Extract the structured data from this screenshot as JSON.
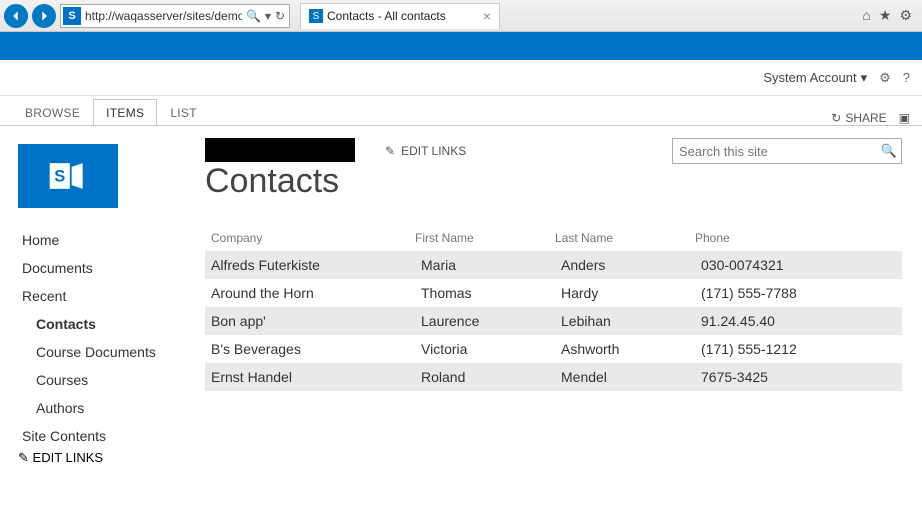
{
  "browser": {
    "url": "http://waqasserver/sites/demo",
    "tab_title": "Contacts - All contacts",
    "home_tip": "Home",
    "fav_tip": "Favorites",
    "tools_tip": "Tools"
  },
  "suite": {
    "account_label": "System Account"
  },
  "ribbon": {
    "tabs": [
      "BROWSE",
      "ITEMS",
      "LIST"
    ],
    "share_label": "SHARE"
  },
  "search": {
    "placeholder": "Search this site"
  },
  "page": {
    "title": "Contacts",
    "edit_links": "EDIT LINKS"
  },
  "nav": [
    {
      "label": "Home",
      "sub": false,
      "sel": false
    },
    {
      "label": "Documents",
      "sub": false,
      "sel": false
    },
    {
      "label": "Recent",
      "sub": false,
      "sel": false
    },
    {
      "label": "Contacts",
      "sub": true,
      "sel": true
    },
    {
      "label": "Course Documents",
      "sub": true,
      "sel": false
    },
    {
      "label": "Courses",
      "sub": true,
      "sel": false
    },
    {
      "label": "Authors",
      "sub": true,
      "sel": false
    },
    {
      "label": "Site Contents",
      "sub": false,
      "sel": false
    }
  ],
  "table": {
    "headers": {
      "company": "Company",
      "first": "First Name",
      "last": "Last Name",
      "phone": "Phone"
    },
    "rows": [
      {
        "company": "Alfreds Futerkiste",
        "first": "Maria",
        "last": "Anders",
        "phone": "030-0074321"
      },
      {
        "company": "Around the Horn",
        "first": "Thomas",
        "last": "Hardy",
        "phone": "(171) 555-7788"
      },
      {
        "company": "Bon app'",
        "first": "Laurence",
        "last": "Lebihan",
        "phone": "91.24.45.40"
      },
      {
        "company": "B's Beverages",
        "first": "Victoria",
        "last": "Ashworth",
        "phone": "(171) 555-1212"
      },
      {
        "company": "Ernst Handel",
        "first": "Roland",
        "last": "Mendel",
        "phone": "7675-3425"
      }
    ]
  }
}
